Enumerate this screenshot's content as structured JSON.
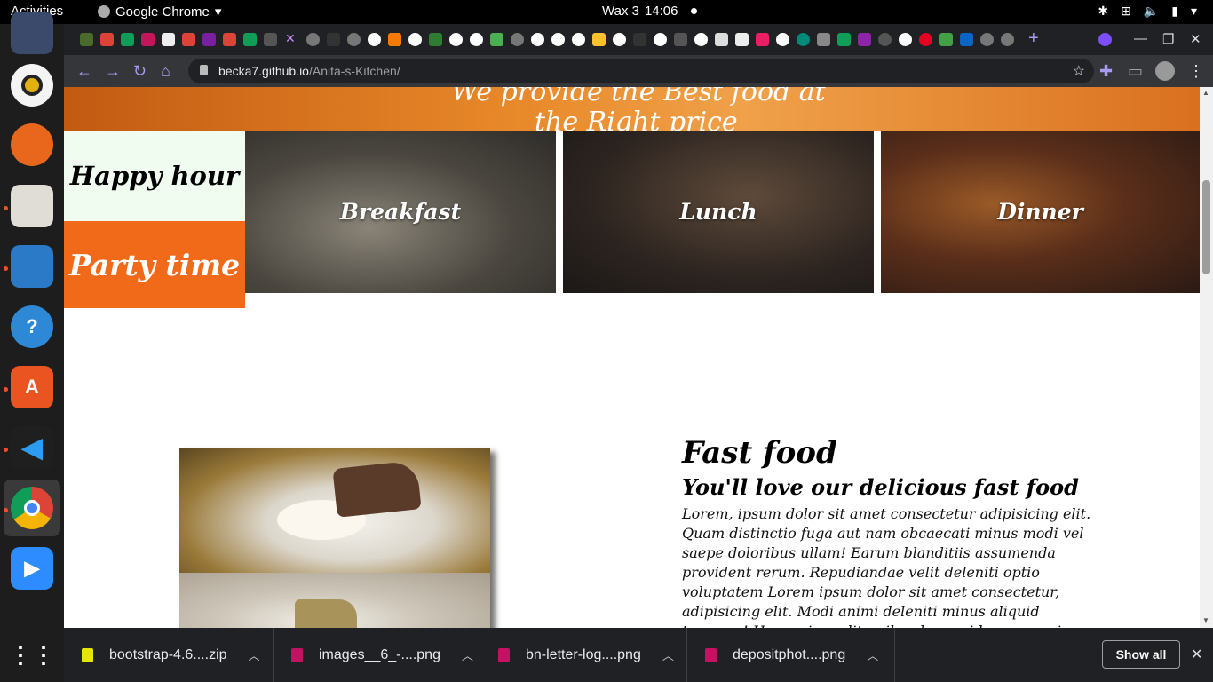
{
  "topbar": {
    "activities": "Activities",
    "app_name": "Google Chrome",
    "workspace": "Wax 3",
    "time": "14:06"
  },
  "browser": {
    "url_host": "becka7.github.io",
    "url_path": "/Anita-s-Kitchen/"
  },
  "page": {
    "hero_line1": "We provide the Best food at",
    "hero_line2": "the Right price",
    "side_tiles": [
      "Happy hour",
      "Party time"
    ],
    "meals": [
      "Breakfast",
      "Lunch",
      "Dinner"
    ],
    "section": {
      "title": "Fast food",
      "subtitle": "You'll love our delicious fast food",
      "body": "Lorem, ipsum dolor sit amet consectetur adipisicing elit. Quam distinctio fuga aut nam obcaecati minus modi vel saepe doloribus ullam! Earum blanditiis assumenda provident rerum. Repudiandae velit deleniti optio voluptatem Lorem ipsum dolor sit amet consectetur, adipisicing elit. Modi animi deleniti minus aliquid tempore! Harum impedit quibusdam quidem corporis..."
    }
  },
  "downloads": {
    "items": [
      "bootstrap-4.6....zip",
      "images__6_-....png",
      "bn-letter-log....png",
      "depositphot....png"
    ],
    "show_all": "Show all"
  },
  "colors": {
    "accent_orange": "#f06a1a",
    "happy_bg": "#effcef",
    "chrome_dark": "#202124"
  }
}
